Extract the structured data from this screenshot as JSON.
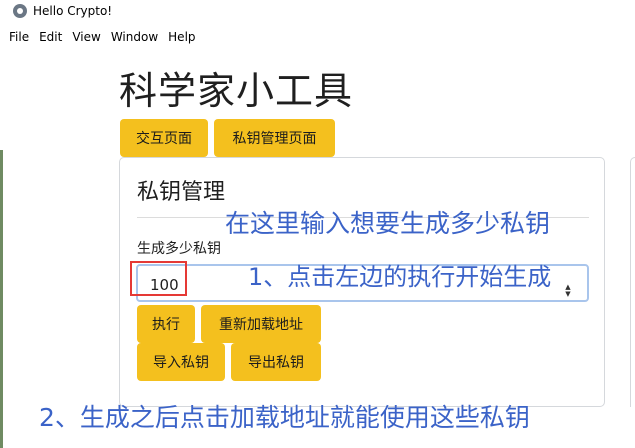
{
  "window": {
    "title": "Hello Crypto!",
    "icon": "electron-icon"
  },
  "menu": [
    "File",
    "Edit",
    "View",
    "Window",
    "Help"
  ],
  "app": {
    "title": "科学家小工具",
    "nav_buttons": [
      "交互页面",
      "私钥管理页面"
    ]
  },
  "card": {
    "title": "私钥管理",
    "field_label": "生成多少私钥",
    "field_value": "100",
    "buttons": {
      "execute": "执行",
      "reload_addresses": "重新加载地址",
      "import_keys": "导入私钥",
      "export_keys": "导出私钥"
    }
  },
  "annotations": {
    "top": "在这里输入想要生成多少私钥",
    "step1": "1、点击左边的执行开始生成",
    "step2": "2、生成之后点击加载地址就能使用这些私钥"
  },
  "colors": {
    "button_bg": "#f4c01e",
    "annotation_text": "#3b63c8",
    "highlight_border": "#e53935",
    "input_focus_border": "#a9c5ec"
  }
}
